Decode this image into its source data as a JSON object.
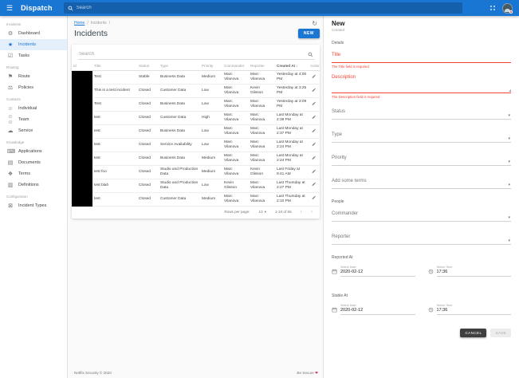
{
  "colors": {
    "primary": "#1976d2",
    "error": "#f44336",
    "heart": "#d81b60"
  },
  "app_bar": {
    "title": "Dispatch",
    "search_placeholder": "Search",
    "icons": [
      "menu-icon",
      "search-icon",
      "apps-grid-icon",
      "avatar"
    ]
  },
  "sidebar": {
    "sections": [
      {
        "label": "Incidents",
        "items": [
          {
            "label": "Dashboard",
            "icon": "dashboard-icon",
            "glyph": "⚙",
            "active": false
          },
          {
            "label": "Incidents",
            "icon": "star-icon",
            "glyph": "★",
            "active": true
          },
          {
            "label": "Tasks",
            "icon": "tasks-icon",
            "glyph": "☑",
            "active": false
          }
        ]
      },
      {
        "label": "Routing",
        "items": [
          {
            "label": "Route",
            "icon": "map-marker-icon",
            "glyph": "⚑",
            "active": false
          },
          {
            "label": "Policies",
            "icon": "policies-icon",
            "glyph": "⚖",
            "active": false
          }
        ]
      },
      {
        "label": "Contacts",
        "items": [
          {
            "label": "Individual",
            "icon": "person-icon",
            "glyph": "☺",
            "active": false
          },
          {
            "label": "Team",
            "icon": "people-icon",
            "glyph": "☺☺",
            "active": false
          },
          {
            "label": "Service",
            "icon": "cloud-icon",
            "glyph": "☁",
            "active": false
          }
        ]
      },
      {
        "label": "Knowledge",
        "items": [
          {
            "label": "Applications",
            "icon": "laptop-icon",
            "glyph": "⌨",
            "active": false
          },
          {
            "label": "Documents",
            "icon": "document-icon",
            "glyph": "▤",
            "active": false
          },
          {
            "label": "Terms",
            "icon": "terms-icon",
            "glyph": "❖",
            "active": false
          },
          {
            "label": "Definitions",
            "icon": "book-icon",
            "glyph": "▥",
            "active": false
          }
        ]
      },
      {
        "label": "Configuration",
        "items": [
          {
            "label": "Incident Types",
            "icon": "incident-types-icon",
            "glyph": "⊠",
            "active": false
          }
        ]
      }
    ]
  },
  "breadcrumb": {
    "home": "Home",
    "current": "Incidents",
    "separator": "/"
  },
  "page": {
    "title": "Incidents",
    "new_button_label": "NEW",
    "refresh_icon": "refresh-icon"
  },
  "incidents_table": {
    "search_placeholder": "Search",
    "columns": [
      "Id",
      "Title",
      "Status",
      "Type",
      "Priority",
      "Commander",
      "Reporter",
      "Created At",
      "Actions"
    ],
    "sorted_column": "Created At",
    "sort_direction": "desc",
    "rows": [
      {
        "id": "",
        "title": "Test",
        "status": "Stable",
        "type": "Business Data",
        "priority": "Medium",
        "commander": "Marc Vilanova",
        "reporter": "Marc Vilanova",
        "created_at": "Yesterday at 4:00 PM"
      },
      {
        "id": "",
        "title": "This is a test incident",
        "status": "Closed",
        "type": "Customer Data",
        "priority": "Low",
        "commander": "Marc Vilanova",
        "reporter": "Kevin Glisson",
        "created_at": "Yesterday at 3:25 PM"
      },
      {
        "id": "",
        "title": "Test",
        "status": "Closed",
        "type": "Business Data",
        "priority": "Low",
        "commander": "Marc Vilanova",
        "reporter": "Marc Vilanova",
        "created_at": "Yesterday at 3:09 PM"
      },
      {
        "id": "",
        "title": "test",
        "status": "Closed",
        "type": "Customer Data",
        "priority": "High",
        "commander": "Marc Vilanova",
        "reporter": "Marc Vilanova",
        "created_at": "Last Monday at 2:39 PM"
      },
      {
        "id": "",
        "title": "test",
        "status": "Closed",
        "type": "Business Data",
        "priority": "Low",
        "commander": "Marc Vilanova",
        "reporter": "Marc Vilanova",
        "created_at": "Last Monday at 2:37 PM"
      },
      {
        "id": "",
        "title": "test",
        "status": "Closed",
        "type": "Service Availability",
        "priority": "Low",
        "commander": "Marc Vilanova",
        "reporter": "Marc Vilanova",
        "created_at": "Last Monday at 2:24 PM"
      },
      {
        "id": "",
        "title": "test",
        "status": "Closed",
        "type": "Business Data",
        "priority": "Medium",
        "commander": "Marc Vilanova",
        "reporter": "Marc Vilanova",
        "created_at": "Last Monday at 2:24 PM"
      },
      {
        "id": "",
        "title": "test foo",
        "status": "Closed",
        "type": "Studio and Production Data",
        "priority": "Medium",
        "commander": "Marc Vilanova",
        "reporter": "Kevin Glisson",
        "created_at": "Last Friday at 9:41 AM"
      },
      {
        "id": "",
        "title": "test blah",
        "status": "Closed",
        "type": "Studio and Production Data",
        "priority": "Low",
        "commander": "Kevin Glisson",
        "reporter": "Marc Vilanova",
        "created_at": "Last Thursday at 2:27 PM"
      },
      {
        "id": "",
        "title": "test",
        "status": "Closed",
        "type": "Customer Data",
        "priority": "Medium",
        "commander": "Marc Vilanova",
        "reporter": "Marc Vilanova",
        "created_at": "Last Thursday at 2:10 PM"
      }
    ],
    "pagination": {
      "rows_per_page_label": "Rows per page:",
      "rows_per_page": "10",
      "range": "1-10 of 65"
    }
  },
  "panel": {
    "title": "New",
    "subtitle": "Created",
    "sections": {
      "details": "Details",
      "people": "People",
      "reported_at": "Reported At",
      "stable_at": "Stable At"
    },
    "fields": {
      "title": {
        "label": "Title",
        "error": "The Title field is required"
      },
      "description": {
        "label": "Description",
        "error": "The Description field is required"
      },
      "status": {
        "label": "Status"
      },
      "type": {
        "label": "Type"
      },
      "priority": {
        "label": "Priority"
      },
      "terms": {
        "label": "Add some terms"
      },
      "commander": {
        "label": "Commander"
      },
      "reporter": {
        "label": "Reporter"
      },
      "reported_date": {
        "label": "Select Date",
        "value": "2020-02-12"
      },
      "reported_time": {
        "label": "Select Time",
        "value": "17:36"
      },
      "stable_date": {
        "label": "Select Date",
        "value": "2020-02-12"
      },
      "stable_time": {
        "label": "Select Time",
        "value": "17:36"
      }
    },
    "buttons": {
      "cancel": "CANCEL",
      "save": "SAVE"
    }
  },
  "footer": {
    "left": "Netflix Security © 2020",
    "right": "Be Secure",
    "heart": "❤"
  }
}
